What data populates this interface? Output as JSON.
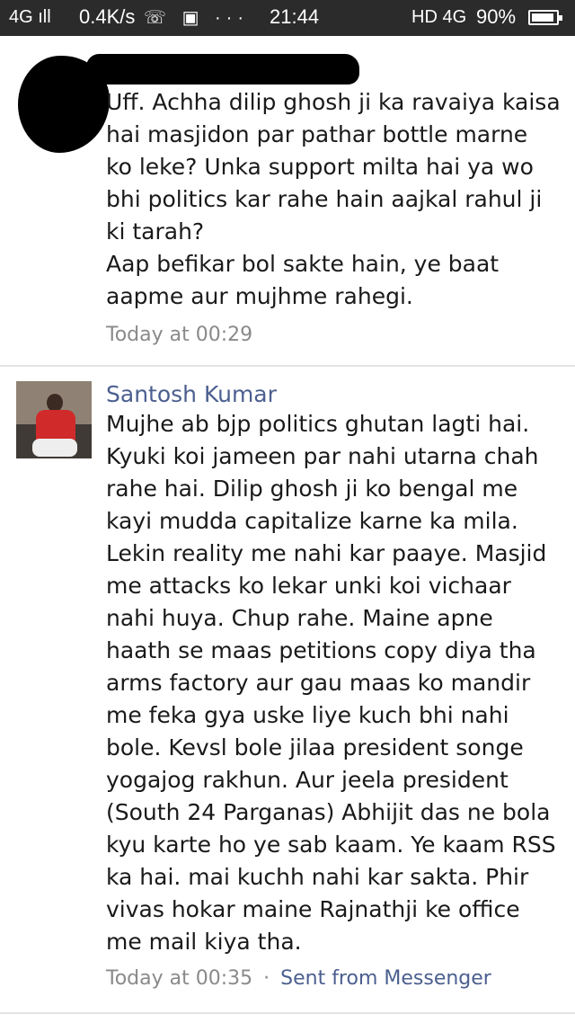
{
  "status_bar": {
    "network": "4G ⚲ıll",
    "speed": "0.4K/s",
    "icons": "○ ▣ ···",
    "time": "21:44",
    "hd": "HD 4G",
    "battery_percent": "90%"
  },
  "comments": [
    {
      "author": "",
      "text": "Uff. Achha dilip ghosh ji ka ravaiya kaisa\nhai masjidon par pathar bottle marne\nko leke? Unka support milta hai ya wo\nbhi politics kar rahe hain aajkal rahul ji\nki tarah?\nAap befikar bol sakte hain, ye baat\naapme aur mujhme rahegi.",
      "timestamp": "Today at 00:29"
    },
    {
      "author": "Santosh Kumar",
      "text": "Mujhe ab bjp politics ghutan lagti hai.\nKyuki koi jameen par nahi utarna chah\nrahe hai. Dilip ghosh ji ko bengal me\nkayi mudda capitalize karne ka mila.\nLekin reality me nahi kar paaye. Masjid\nme attacks ko lekar unki koi vichaar\nnahi huya. Chup rahe. Maine apne\nhaath se maas petitions copy diya tha\narms factory aur gau maas ko mandir\nme feka gya uske liye kuch bhi nahi\nbole. Kevsl bole jilaa president songe\nyogajog rakhun. Aur jeela president\n(South 24 Parganas) Abhijit das ne bola\nkyu karte ho ye sab kaam. Ye kaam RSS\nka hai. mai kuchh nahi kar sakta. Phir\nvivas hokar maine Rajnathji ke office\nme mail kiya tha.",
      "timestamp": "Today at 00:35",
      "separator": "·",
      "source": "Sent from Messenger"
    }
  ]
}
